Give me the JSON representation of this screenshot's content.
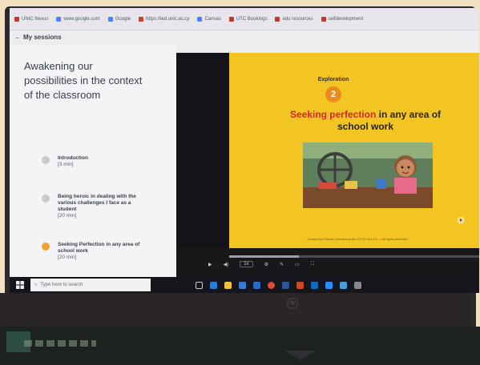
{
  "browser": {
    "bookmarks": [
      {
        "label": "UNIC Nexus",
        "color": "#c0392b"
      },
      {
        "label": "www.google.com",
        "color": "#4285f4"
      },
      {
        "label": "Google",
        "color": "#4285f4"
      },
      {
        "label": "https://ied.unic.ac.cy",
        "color": "#d04030"
      },
      {
        "label": "Canvas",
        "color": "#4285f4"
      },
      {
        "label": "UTC Bookings",
        "color": "#c0392b"
      },
      {
        "label": "edu resources",
        "color": "#c0392b"
      },
      {
        "label": "selfdevelopment",
        "color": "#c0392b"
      }
    ]
  },
  "nav": {
    "back_label": "My sessions"
  },
  "course": {
    "title": "Awakening our possibilities in the context of the classroom",
    "modules": [
      {
        "title": "Introduction",
        "duration": "[3 min]",
        "active": false
      },
      {
        "title": "Being heroic in dealing with the various challenges I face as a student",
        "duration": "[20 min]",
        "active": false
      },
      {
        "title": "Seeking Perfection in any area of school work",
        "duration": "[20 min]",
        "active": true
      }
    ]
  },
  "slide": {
    "label": "Exploration",
    "number": "2",
    "title_highlight": "Seeking perfection",
    "title_rest": " in any area of school work",
    "caption": "Created by Bitmoji, licensed under CC BY-SA 4.0 — All rights reserved"
  },
  "player": {
    "speed_label": "1x",
    "progress_fraction": 0.28
  },
  "taskbar": {
    "search_placeholder": "Type here to search"
  },
  "colors": {
    "slide_bg": "#f2c522",
    "accent_orange": "#ec8b1d",
    "highlight_red": "#d6262e"
  }
}
